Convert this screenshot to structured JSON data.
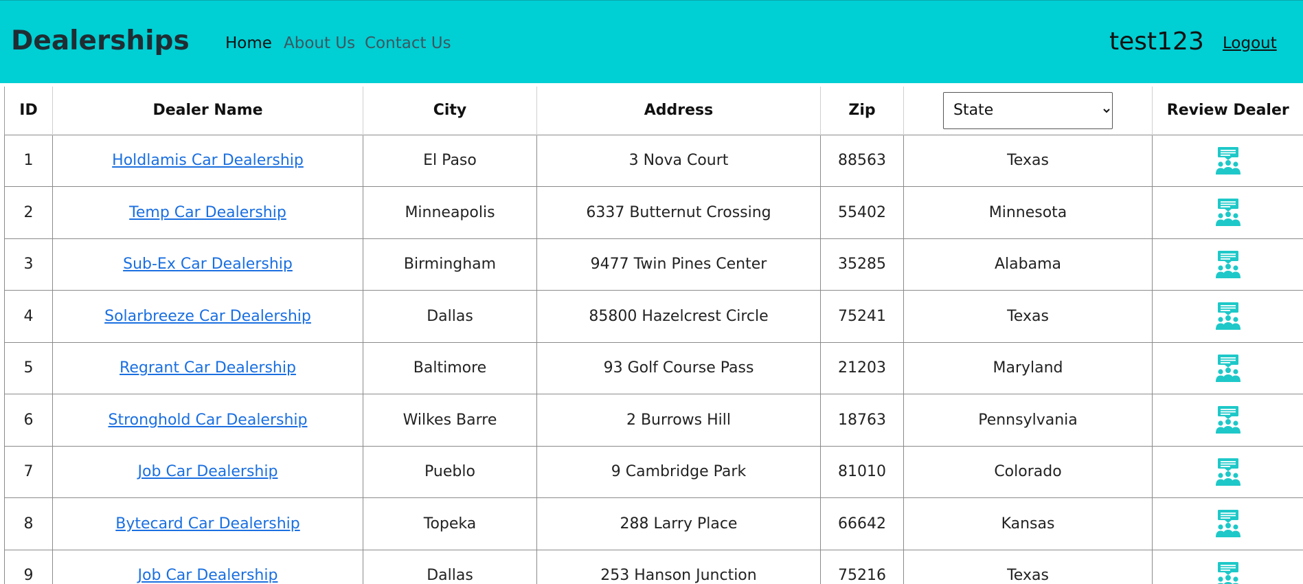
{
  "navbar": {
    "brand": "Dealerships",
    "links": [
      {
        "label": "Home",
        "active": true
      },
      {
        "label": "About Us",
        "active": false
      },
      {
        "label": "Contact Us",
        "active": false
      }
    ],
    "username": "test123",
    "logout_label": "Logout",
    "color": "#00cfd4"
  },
  "table": {
    "headers": {
      "id": "ID",
      "name": "Dealer Name",
      "city": "City",
      "address": "Address",
      "zip": "Zip",
      "state_select": "State",
      "review": "Review Dealer"
    },
    "rows": [
      {
        "id": "1",
        "name": "Holdlamis Car Dealership",
        "city": "El Paso",
        "address": "3 Nova Court",
        "zip": "88563",
        "state": "Texas"
      },
      {
        "id": "2",
        "name": "Temp Car Dealership",
        "city": "Minneapolis",
        "address": "6337 Butternut Crossing",
        "zip": "55402",
        "state": "Minnesota"
      },
      {
        "id": "3",
        "name": "Sub-Ex Car Dealership",
        "city": "Birmingham",
        "address": "9477 Twin Pines Center",
        "zip": "35285",
        "state": "Alabama"
      },
      {
        "id": "4",
        "name": "Solarbreeze Car Dealership",
        "city": "Dallas",
        "address": "85800 Hazelcrest Circle",
        "zip": "75241",
        "state": "Texas"
      },
      {
        "id": "5",
        "name": "Regrant Car Dealership",
        "city": "Baltimore",
        "address": "93 Golf Course Pass",
        "zip": "21203",
        "state": "Maryland"
      },
      {
        "id": "6",
        "name": "Stronghold Car Dealership",
        "city": "Wilkes Barre",
        "address": "2 Burrows Hill",
        "zip": "18763",
        "state": "Pennsylvania"
      },
      {
        "id": "7",
        "name": "Job Car Dealership",
        "city": "Pueblo",
        "address": "9 Cambridge Park",
        "zip": "81010",
        "state": "Colorado"
      },
      {
        "id": "8",
        "name": "Bytecard Car Dealership",
        "city": "Topeka",
        "address": "288 Larry Place",
        "zip": "66642",
        "state": "Kansas"
      },
      {
        "id": "9",
        "name": "Job Car Dealership",
        "city": "Dallas",
        "address": "253 Hanson Junction",
        "zip": "75216",
        "state": "Texas"
      }
    ],
    "review_icon": "review-dealer-icon",
    "icon_color": "#1ec8c8"
  }
}
